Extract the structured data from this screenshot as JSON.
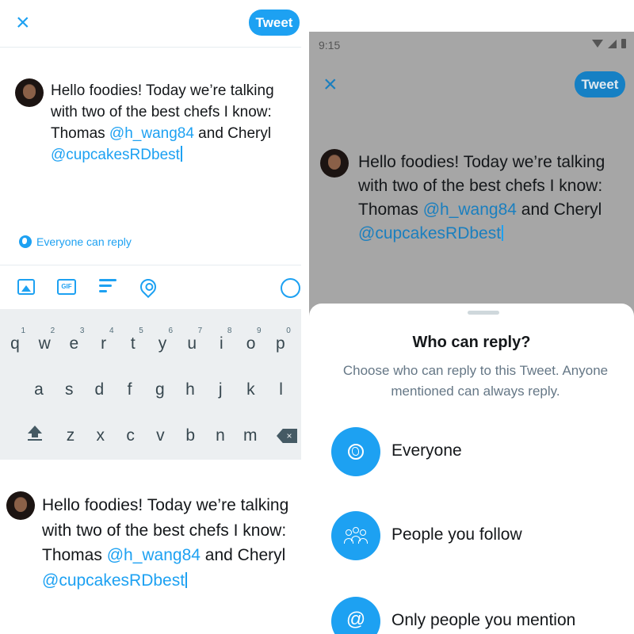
{
  "composer": {
    "close_glyph": "×",
    "tweet_label": "Tweet",
    "text_plain_1": "Hello foodies! Today we’re talking with two of the best chefs I know: Thomas ",
    "mention_1": "@h_wang84",
    "text_plain_2": " and Cheryl ",
    "mention_2": "@cupcakesRDbest",
    "reply_setting": "Everyone can reply",
    "toolbar_icons": [
      "image-icon",
      "gif-icon",
      "poll-icon",
      "location-icon",
      "character-counter"
    ],
    "gif_label": "GIF"
  },
  "keyboard": {
    "row1": [
      "q",
      "w",
      "e",
      "r",
      "t",
      "y",
      "u",
      "i",
      "o",
      "p"
    ],
    "row1_hints": [
      "1",
      "2",
      "3",
      "4",
      "5",
      "6",
      "7",
      "8",
      "9",
      "0"
    ],
    "row2": [
      "a",
      "s",
      "d",
      "f",
      "g",
      "h",
      "j",
      "k",
      "l"
    ],
    "row3": [
      "z",
      "x",
      "c",
      "v",
      "b",
      "n",
      "m"
    ]
  },
  "phone": {
    "status_time": "9:15",
    "tweet_label": "Tweet",
    "close_glyph": "×"
  },
  "reply_sheet": {
    "title": "Who can reply?",
    "description": "Choose who can reply to this Tweet. Anyone mentioned can always reply.",
    "options": [
      {
        "label": "Everyone",
        "icon": "globe-icon"
      },
      {
        "label": "People you follow",
        "icon": "people-icon"
      },
      {
        "label": "Only people you mention",
        "icon": "at-icon"
      }
    ],
    "at_glyph": "@"
  },
  "colors": {
    "accent": "#1da1f2",
    "overlay": "#a6a6a6",
    "keyboard_bg": "#eceff1"
  }
}
